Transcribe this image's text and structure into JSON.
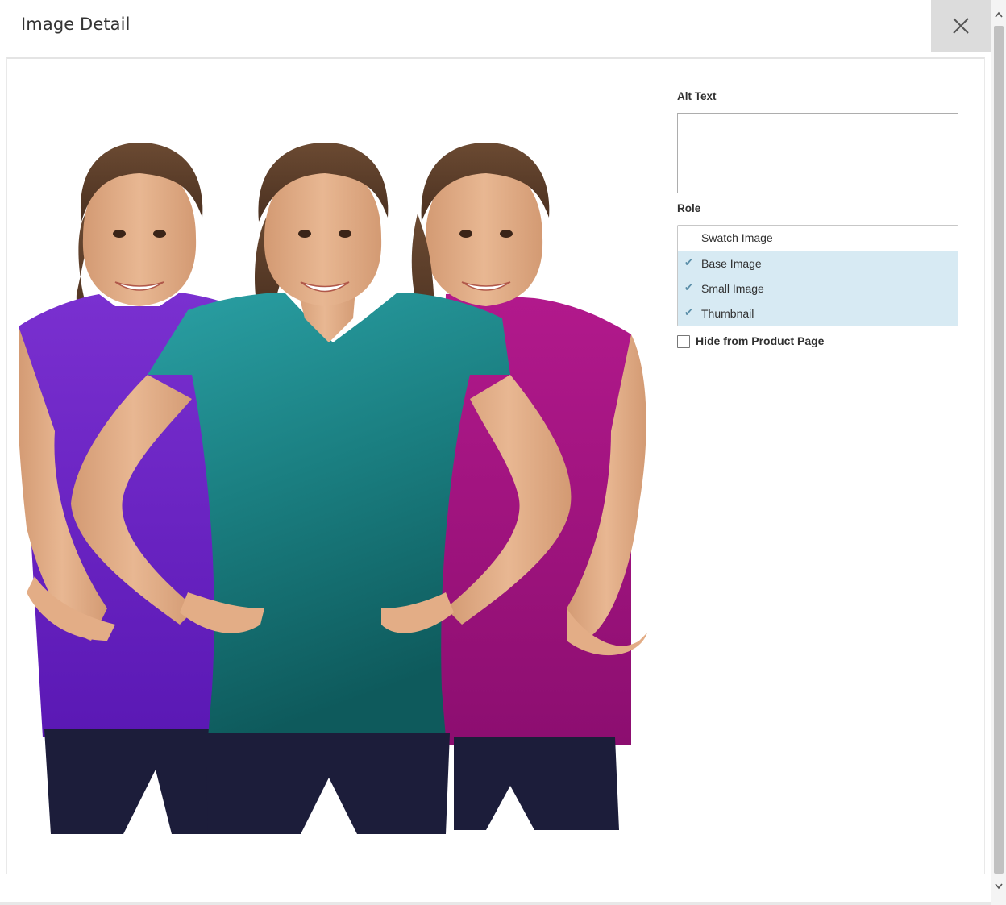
{
  "modal": {
    "title": "Image Detail",
    "close_icon": "close-icon"
  },
  "form": {
    "alt_text_label": "Alt Text",
    "alt_text_value": "",
    "role_label": "Role",
    "roles": [
      {
        "label": "Swatch Image",
        "selected": false
      },
      {
        "label": "Base Image",
        "selected": true
      },
      {
        "label": "Small Image",
        "selected": true
      },
      {
        "label": "Thumbnail",
        "selected": true
      }
    ],
    "hide_label": "Hide from Product Page",
    "hide_checked": false
  },
  "image": {
    "subject": "product-photo",
    "shirt_colors": [
      "#6a22c4",
      "#1f8a8c",
      "#a0137e"
    ]
  },
  "colors": {
    "selected_bg": "#d7eaf3",
    "check": "#5a8ea8",
    "close_bg": "#dcdcdc"
  }
}
